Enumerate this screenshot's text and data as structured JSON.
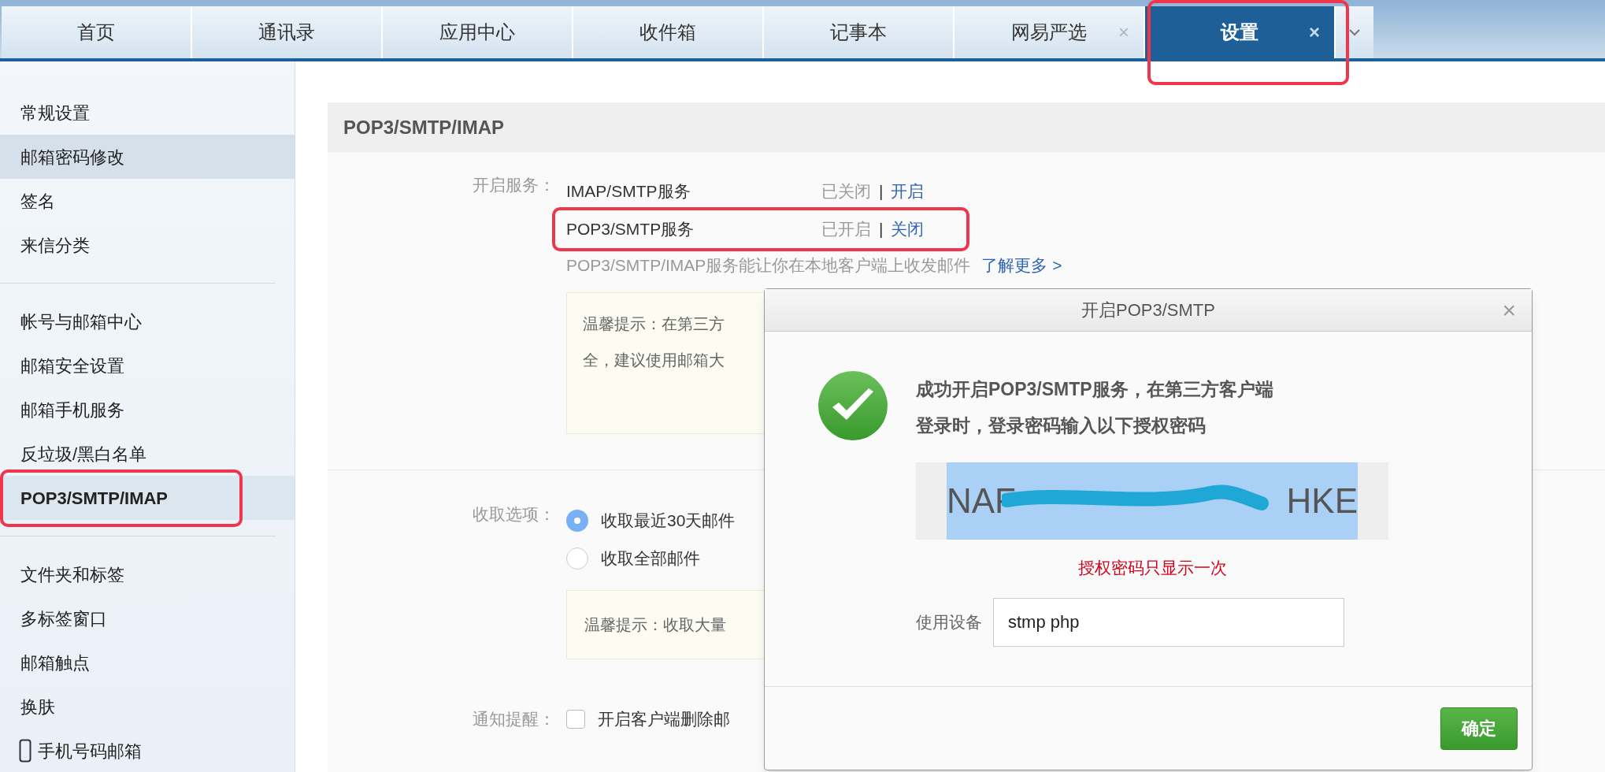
{
  "tabs": [
    {
      "label": "首页",
      "selected": false,
      "highlighted": false
    },
    {
      "label": "通讯录",
      "selected": false,
      "highlighted": false
    },
    {
      "label": "应用中心",
      "selected": false,
      "highlighted": false
    },
    {
      "label": "收件箱",
      "selected": false,
      "highlighted": false
    },
    {
      "label": "记事本",
      "selected": false,
      "highlighted": false
    },
    {
      "label": "网易严选",
      "selected": false,
      "close_icon": "×",
      "highlighted": false
    },
    {
      "label": "设置",
      "selected": true,
      "close_icon": "×",
      "highlighted": true
    }
  ],
  "sidebar": {
    "groups": [
      {
        "items": [
          {
            "label": "常规设置",
            "selected": false,
            "hovered": false,
            "highlighted": false
          },
          {
            "label": "邮箱密码修改",
            "selected": false,
            "hovered": true,
            "highlighted": false
          },
          {
            "label": "签名",
            "selected": false,
            "hovered": false,
            "highlighted": false
          },
          {
            "label": "来信分类",
            "selected": false,
            "hovered": false,
            "highlighted": false
          }
        ]
      },
      {
        "items": [
          {
            "label": "帐号与邮箱中心",
            "selected": false,
            "hovered": false,
            "highlighted": false
          },
          {
            "label": "邮箱安全设置",
            "selected": false,
            "hovered": false,
            "highlighted": false
          },
          {
            "label": "邮箱手机服务",
            "selected": false,
            "hovered": false,
            "highlighted": false
          },
          {
            "label": "反垃圾/黑白名单",
            "selected": false,
            "hovered": false,
            "highlighted": false
          },
          {
            "label": "POP3/SMTP/IMAP",
            "selected": true,
            "hovered": false,
            "highlighted": true
          }
        ]
      },
      {
        "items": [
          {
            "label": "文件夹和标签",
            "selected": false,
            "hovered": false,
            "highlighted": false
          },
          {
            "label": "多标签窗口",
            "selected": false,
            "hovered": false,
            "highlighted": false
          },
          {
            "label": "邮箱触点",
            "selected": false,
            "hovered": false,
            "highlighted": false
          },
          {
            "label": "换肤",
            "selected": false,
            "hovered": false,
            "highlighted": false
          },
          {
            "label": "手机号码邮箱",
            "selected": false,
            "hovered": false,
            "highlighted": false,
            "kind": "phone"
          }
        ]
      }
    ]
  },
  "panel": {
    "title": "POP3/SMTP/IMAP",
    "services_label": "开启服务：",
    "services": [
      {
        "name": "IMAP/SMTP服务",
        "status": "已关闭",
        "separator": "|",
        "action": "开启",
        "highlighted": false
      },
      {
        "name": "POP3/SMTP服务",
        "status": "已开启",
        "separator": "|",
        "action": "关闭",
        "highlighted": true
      }
    ],
    "info": "POP3/SMTP/IMAP服务能让你在本地客户端上收发邮件",
    "info_link": "了解更多 >",
    "tip_lines": [
      "温馨提示：在第三方",
      "全，建议使用邮箱大"
    ],
    "fetch_label": "收取选项：",
    "fetch_options": [
      {
        "label": "收取最近30天邮件",
        "selected": true
      },
      {
        "label": "收取全部邮件",
        "selected": false
      }
    ],
    "fetch_tip": "温馨提示：收取大量",
    "notify_label": "通知提醒：",
    "notify_option": {
      "label": "开启客户端删除邮",
      "checked": false
    }
  },
  "dialog": {
    "title": "开启POP3/SMTP",
    "close": "×",
    "message": "成功开启**POP3/SMTP**服务，在第三方客户端登录时，登录密码输入以下授权密码",
    "code_start": "NAF",
    "code_end": "HKE",
    "warning": "授权密码只显示一次",
    "device_label": "使用设备",
    "device_value": "stmp php",
    "confirm": "确定"
  }
}
